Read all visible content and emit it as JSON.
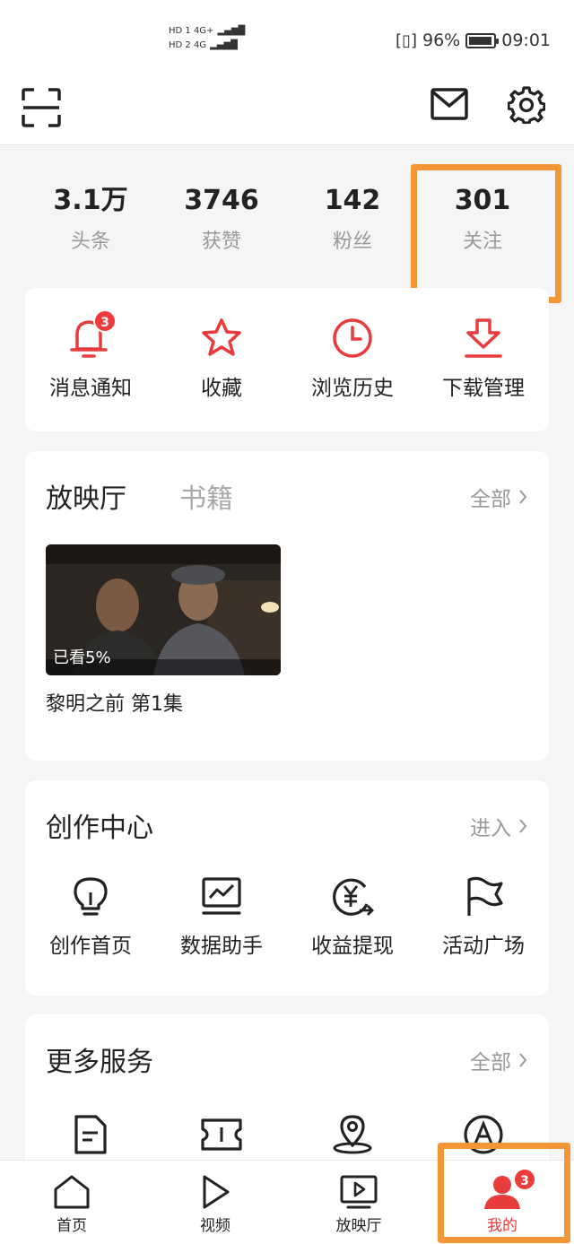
{
  "status_bar": {
    "sim1": "HD 1 4G+",
    "sim2": "HD 2 4G",
    "battery": "96%",
    "time": "09:01"
  },
  "top_bar": {
    "icons": [
      "scan-icon",
      "mail-icon",
      "gear-icon"
    ]
  },
  "stats": [
    {
      "value": "3.1万",
      "label": "头条"
    },
    {
      "value": "3746",
      "label": "获赞"
    },
    {
      "value": "142",
      "label": "粉丝"
    },
    {
      "value": "301",
      "label": "关注"
    }
  ],
  "quick_actions": [
    {
      "label": "消息通知",
      "icon": "bell-icon",
      "badge": "3"
    },
    {
      "label": "收藏",
      "icon": "star-icon"
    },
    {
      "label": "浏览历史",
      "icon": "clock-icon"
    },
    {
      "label": "下载管理",
      "icon": "download-icon"
    }
  ],
  "theater": {
    "tab_active": "放映厅",
    "tab_inactive": "书籍",
    "more": "全部",
    "video": {
      "progress_label": "已看5%",
      "progress": 0.05,
      "title": "黎明之前 第1集"
    }
  },
  "creation_center": {
    "title": "创作中心",
    "more": "进入",
    "items": [
      {
        "label": "创作首页",
        "icon": "lightbulb-icon"
      },
      {
        "label": "数据助手",
        "icon": "chart-icon"
      },
      {
        "label": "收益提现",
        "icon": "yuan-withdraw-icon"
      },
      {
        "label": "活动广场",
        "icon": "flag-icon"
      }
    ]
  },
  "more_services": {
    "title": "更多服务",
    "more": "全部",
    "icons": [
      "document-icon",
      "ticket-icon",
      "location-icon",
      "a-circle-icon"
    ]
  },
  "bottom_nav": [
    {
      "label": "首页",
      "icon": "home-icon"
    },
    {
      "label": "视频",
      "icon": "play-icon"
    },
    {
      "label": "放映厅",
      "icon": "tv-play-icon"
    },
    {
      "label": "我的",
      "icon": "user-icon",
      "badge": "3",
      "active": true
    }
  ],
  "colors": {
    "accent": "#e83b3b",
    "highlight": "#f39638"
  }
}
